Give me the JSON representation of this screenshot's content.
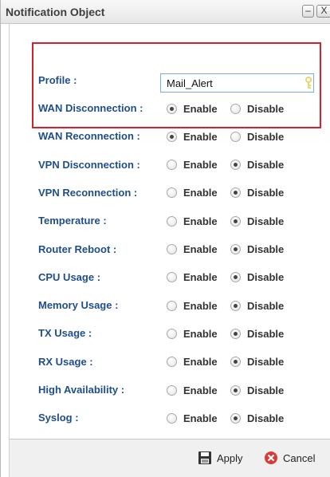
{
  "window": {
    "title": "Notification Object",
    "minimize_glyph": "–",
    "close_glyph": "X"
  },
  "colors": {
    "label": "#1f4e8c",
    "highlight": "#d6202e",
    "input_border": "#78aee0"
  },
  "profile": {
    "label": "Profile :",
    "value": "Mail_Alert",
    "icon": "key-icon"
  },
  "options": {
    "enable": "Enable",
    "disable": "Disable"
  },
  "events": [
    {
      "label": "WAN Disconnection :",
      "selected": "enable"
    },
    {
      "label": "WAN Reconnection :",
      "selected": "enable"
    },
    {
      "label": "VPN Disconnection :",
      "selected": "disable"
    },
    {
      "label": "VPN Reconnection :",
      "selected": "disable"
    },
    {
      "label": "Temperature :",
      "selected": "disable"
    },
    {
      "label": "Router Reboot :",
      "selected": "disable"
    },
    {
      "label": "CPU Usage :",
      "selected": "disable"
    },
    {
      "label": "Memory Usage :",
      "selected": "disable"
    },
    {
      "label": "TX Usage :",
      "selected": "disable"
    },
    {
      "label": "RX Usage :",
      "selected": "disable"
    },
    {
      "label": "High Availability :",
      "selected": "disable"
    },
    {
      "label": "Syslog :",
      "selected": "disable"
    }
  ],
  "footer": {
    "apply_label": "Apply",
    "apply_icon": "save-icon",
    "cancel_label": "Cancel",
    "cancel_icon": "cancel-icon"
  }
}
